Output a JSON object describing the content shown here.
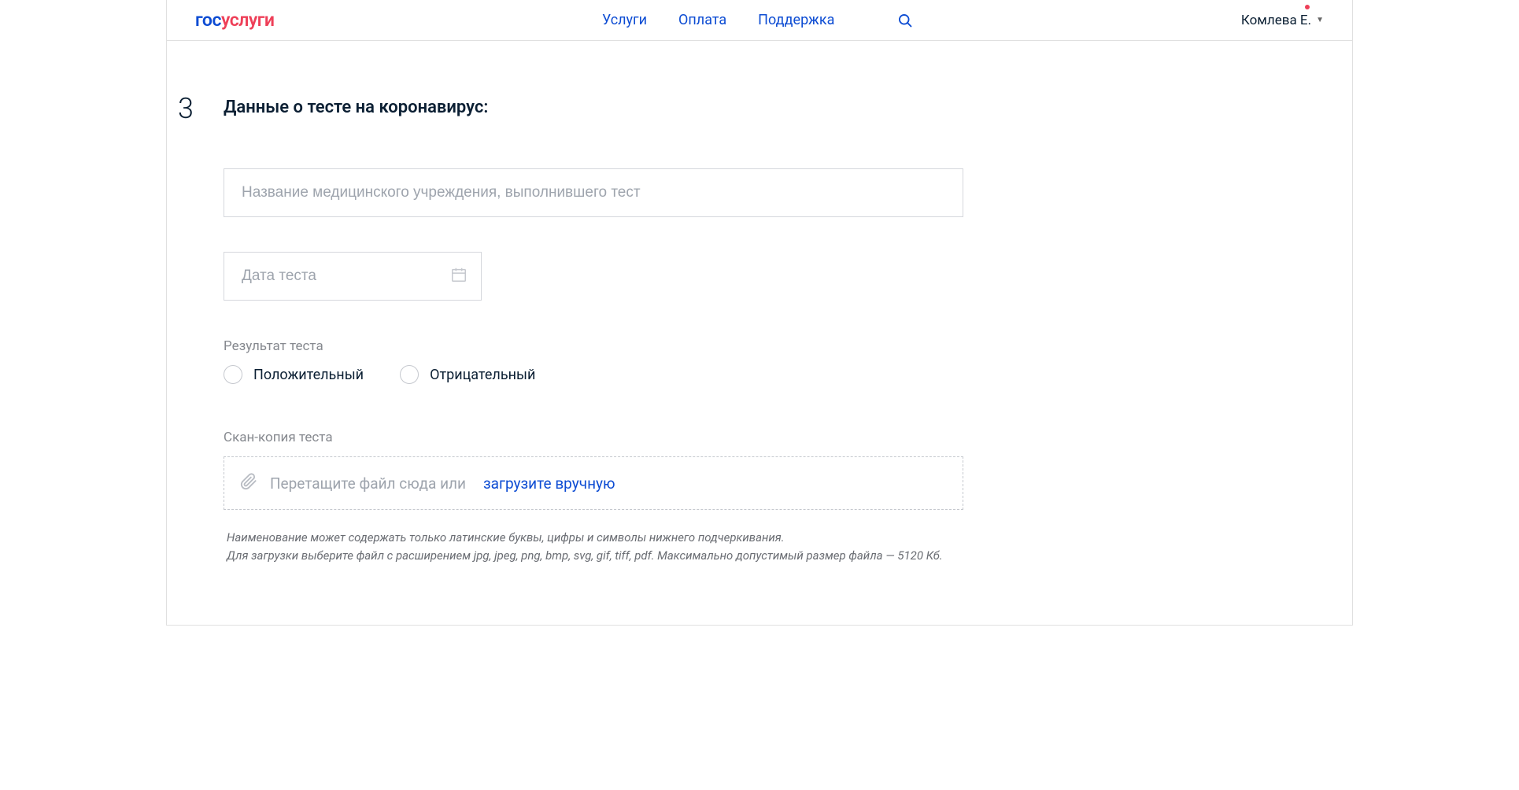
{
  "header": {
    "logo": {
      "part1": "гос",
      "part2": "услуги"
    },
    "nav": {
      "services": "Услуги",
      "payment": "Оплата",
      "support": "Поддержка"
    },
    "user": {
      "name": "Комлева Е."
    }
  },
  "step": {
    "number": "3",
    "title": "Данные о тесте на коронавирус:"
  },
  "form": {
    "institution_placeholder": "Название медицинского учреждения, выполнившего тест",
    "date_placeholder": "Дата теста",
    "result_label": "Результат теста",
    "result_options": {
      "positive": "Положительный",
      "negative": "Отрицательный"
    },
    "scan_label": "Скан-копия теста",
    "upload_text": "Перетащите файл сюда или",
    "upload_link": "загрузите вручную",
    "hint_line1": "Наименование может содержать только латинские буквы, цифры и символы нижнего подчеркивания.",
    "hint_line2": "Для загрузки выберите файл с расширением jpg, jpeg, png, bmp, svg, gif, tiff, pdf. Максимально допустимый размер файла — 5120 Кб."
  }
}
